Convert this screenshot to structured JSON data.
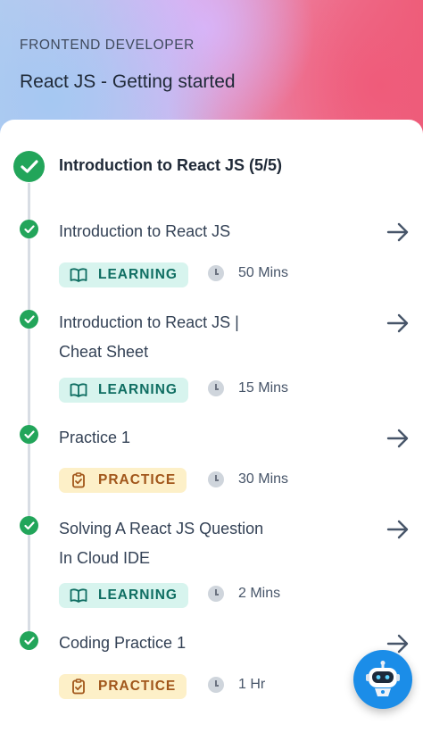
{
  "header": {
    "kicker": "FRONTEND DEVELOPER",
    "title": "React JS - Getting started"
  },
  "module": {
    "title": "Introduction to React JS (5/5)",
    "status": "completed"
  },
  "items": [
    {
      "title": "Introduction to React JS",
      "tag": "LEARNING",
      "tag_icon": "book-icon",
      "duration": "50 Mins"
    },
    {
      "title": "Introduction to React JS | Cheat Sheet",
      "tag": "LEARNING",
      "tag_icon": "book-icon",
      "duration": "15 Mins"
    },
    {
      "title": "Practice 1",
      "tag": "PRACTICE",
      "tag_icon": "clipboard-check-icon",
      "duration": "30 Mins"
    },
    {
      "title": "Solving A React JS Question In Cloud IDE",
      "tag": "LEARNING",
      "tag_icon": "book-icon",
      "duration": "2 Mins"
    },
    {
      "title": "Coding Practice 1",
      "tag": "PRACTICE",
      "tag_icon": "clipboard-check-icon",
      "duration": "1 Hr"
    }
  ],
  "colors": {
    "check": "#22a55a",
    "learning_bg": "#d7f4ee",
    "learning_fg": "#0f6e62",
    "practice_bg": "#fdf0c8",
    "practice_fg": "#a1561a",
    "bot": "#1b8de8"
  },
  "bot": {
    "icon": "robot-assistant-icon"
  }
}
